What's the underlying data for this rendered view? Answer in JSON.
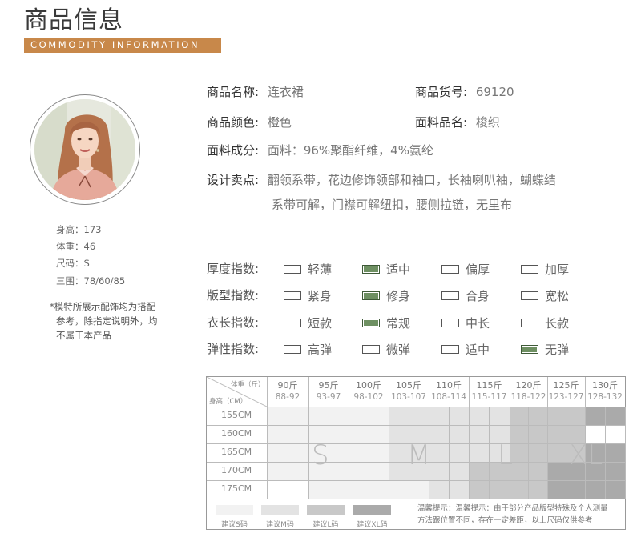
{
  "header": {
    "title_cn": "商品信息",
    "title_en": "COMMODITY INFORMATION"
  },
  "model": {
    "height_label": "身高：173",
    "weight_label": "体重：46",
    "size_label": "尺码：S",
    "measure_label": "三围：78/60/85",
    "note_lines": [
      "*模特所展示配饰均为搭配",
      "参考，除指定说明外，均",
      "不属于本产品"
    ]
  },
  "product": {
    "name_label": "商品名称:",
    "name_value": "连衣裙",
    "sku_label": "商品货号:",
    "sku_value": "69120",
    "color_label": "商品颜色:",
    "color_value": "橙色",
    "fabric_name_label": "面料品名:",
    "fabric_name_value": "梭织",
    "composition_label": "面料成分:",
    "composition_value": "面料：96%聚酯纤维，4%氨纶",
    "design_label": "设计卖点:",
    "design_line1": "翻领系带，花边修饰领部和袖口，长袖喇叭袖，蝴蝶结",
    "design_line2": "系带可解，门襟可解纽扣，腰侧拉链，无里布"
  },
  "indices": [
    {
      "label": "厚度指数:",
      "options": [
        "轻薄",
        "适中",
        "偏厚",
        "加厚"
      ],
      "selected": 1
    },
    {
      "label": "版型指数:",
      "options": [
        "紧身",
        "修身",
        "合身",
        "宽松"
      ],
      "selected": 1
    },
    {
      "label": "衣长指数:",
      "options": [
        "短款",
        "常规",
        "中长",
        "长款"
      ],
      "selected": 1
    },
    {
      "label": "弹性指数:",
      "options": [
        "高弹",
        "微弹",
        "适中",
        "无弹"
      ],
      "selected": 3
    }
  ],
  "size_table": {
    "corner_weight": "体重（斤）",
    "corner_height": "身高（CM）",
    "weights": [
      {
        "jin": "90斤",
        "range": "88-92"
      },
      {
        "jin": "95斤",
        "range": "93-97"
      },
      {
        "jin": "100斤",
        "range": "98-102"
      },
      {
        "jin": "105斤",
        "range": "103-107"
      },
      {
        "jin": "110斤",
        "range": "108-114"
      },
      {
        "jin": "115斤",
        "range": "115-117"
      },
      {
        "jin": "120斤",
        "range": "118-122"
      },
      {
        "jin": "125斤",
        "range": "123-127"
      },
      {
        "jin": "130斤",
        "range": "128-132"
      }
    ],
    "heights": [
      "155CM",
      "160CM",
      "165CM",
      "170CM",
      "175CM"
    ],
    "size_marks": [
      "S",
      "M",
      "L",
      "XL"
    ],
    "legend": [
      "建议S码",
      "建议M码",
      "建议L码",
      "建议XL码"
    ],
    "tip_line1": "温馨提示：温馨提示：由于部分产品版型特殊及个人测量",
    "tip_line2": "方法跟位置不同，存在一定差距，以上尺码仅供参考"
  },
  "colors": {
    "accent": "#c8884a",
    "checked": "#6e9062",
    "s": "#f2f2f2",
    "m": "#e3e3e3",
    "l": "#c8c8c8",
    "xl": "#aaaaaa"
  }
}
